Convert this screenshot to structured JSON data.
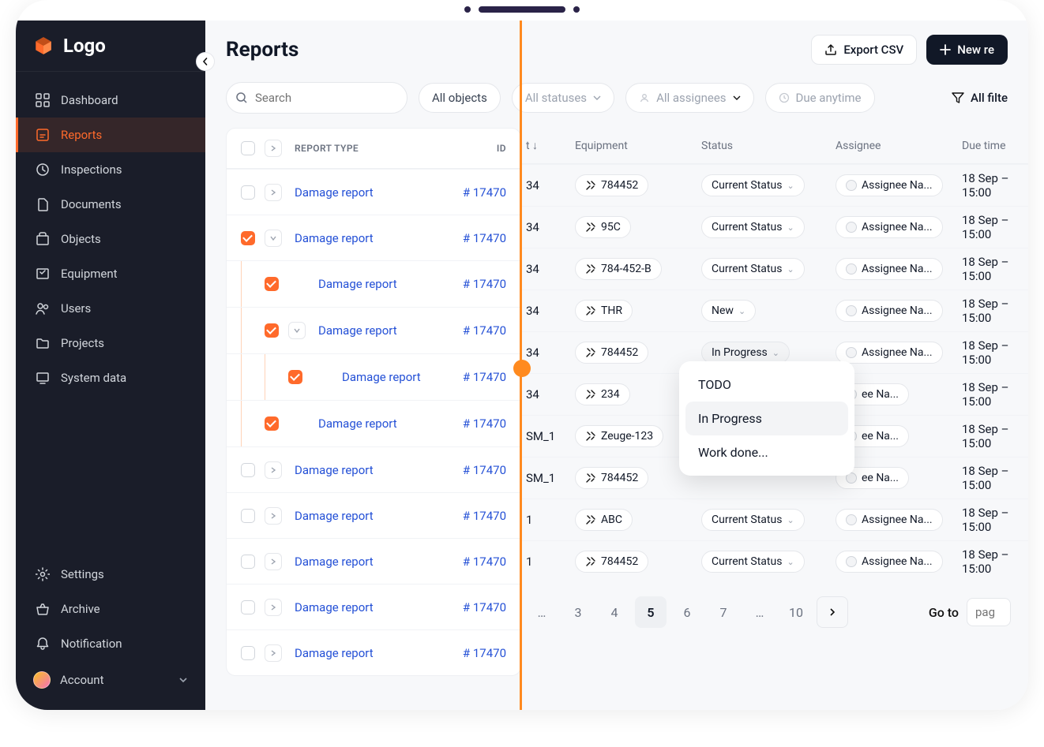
{
  "brand": {
    "name": "Logo"
  },
  "sidebar": {
    "items": [
      {
        "label": "Dashboard",
        "icon": "grid-icon"
      },
      {
        "label": "Reports",
        "icon": "report-icon",
        "active": true
      },
      {
        "label": "Inspections",
        "icon": "clock-icon"
      },
      {
        "label": "Documents",
        "icon": "file-icon"
      },
      {
        "label": "Objects",
        "icon": "building-icon"
      },
      {
        "label": "Equipment",
        "icon": "equipment-icon"
      },
      {
        "label": "Users",
        "icon": "users-icon"
      },
      {
        "label": "Projects",
        "icon": "folder-icon"
      },
      {
        "label": "System data",
        "icon": "monitor-icon"
      }
    ],
    "bottom": [
      {
        "label": "Settings",
        "icon": "gear-icon"
      },
      {
        "label": "Archive",
        "icon": "basket-icon"
      },
      {
        "label": "Notification",
        "icon": "bell-icon"
      }
    ],
    "account_label": "Account"
  },
  "header": {
    "title": "Reports",
    "export_label": "Export CSV",
    "new_label": "New re"
  },
  "filters": {
    "search_placeholder": "Search",
    "objects_label": "All objects",
    "statuses_label": "All statuses",
    "assignees_label": "All assignees",
    "due_label": "Due anytime",
    "allfilters_label": "All filte"
  },
  "left_table": {
    "col_type": "REPORT TYPE",
    "col_id": "ID",
    "rows": [
      {
        "checked": false,
        "expand": "right",
        "indent": 0,
        "type": "Damage report",
        "id": "# 17470"
      },
      {
        "checked": true,
        "expand": "down",
        "indent": 0,
        "type": "Damage report",
        "id": "# 17470"
      },
      {
        "checked": true,
        "expand": "none",
        "indent": 1,
        "type": "Damage report",
        "id": "# 17470"
      },
      {
        "checked": true,
        "expand": "down",
        "indent": 1,
        "type": "Damage report",
        "id": "# 17470"
      },
      {
        "checked": true,
        "expand": "none",
        "indent": 2,
        "type": "Damage report",
        "id": "# 17470"
      },
      {
        "checked": true,
        "expand": "none",
        "indent": 1,
        "type": "Damage report",
        "id": "# 17470"
      },
      {
        "checked": false,
        "expand": "right",
        "indent": 0,
        "type": "Damage report",
        "id": "# 17470"
      },
      {
        "checked": false,
        "expand": "right",
        "indent": 0,
        "type": "Damage report",
        "id": "# 17470"
      },
      {
        "checked": false,
        "expand": "right",
        "indent": 0,
        "type": "Damage report",
        "id": "# 17470"
      },
      {
        "checked": false,
        "expand": "right",
        "indent": 0,
        "type": "Damage report",
        "id": "# 17470"
      },
      {
        "checked": false,
        "expand": "right",
        "indent": 0,
        "type": "Damage report",
        "id": "# 17470"
      }
    ]
  },
  "right_table": {
    "col_t": "t ↓",
    "col_eq": "Equipment",
    "col_st": "Status",
    "col_as": "Assignee",
    "col_dt": "Due time",
    "rows": [
      {
        "t": "34",
        "eq": "784452",
        "status": "Current Status",
        "assignee": "Assignee Na...",
        "due": "18 Sep – 15:00"
      },
      {
        "t": "34",
        "eq": "95C",
        "status": "Current Status",
        "assignee": "Assignee Na...",
        "due": "18 Sep – 15:00"
      },
      {
        "t": "34",
        "eq": "784-452-B",
        "status": "Current Status",
        "assignee": "Assignee Na...",
        "due": "18 Sep – 15:00"
      },
      {
        "t": "34",
        "eq": "THR",
        "status": "New",
        "assignee": "Assignee Na...",
        "due": "18 Sep – 15:00"
      },
      {
        "t": "34",
        "eq": "784452",
        "status": "In Progress",
        "status_open": true,
        "assignee": "Assignee Na...",
        "due": "18 Sep – 15:00"
      },
      {
        "t": "34",
        "eq": "234",
        "status": "",
        "assignee": "ee Na...",
        "due": "18 Sep – 15:00"
      },
      {
        "t": "SM_1",
        "eq": "Zeuge-123",
        "status": "",
        "assignee": "ee Na...",
        "due": "18 Sep – 15:00"
      },
      {
        "t": "SM_1",
        "eq": "784452",
        "status": "",
        "assignee": "ee Na...",
        "due": "18 Sep – 15:00"
      },
      {
        "t": "1",
        "eq": "ABC",
        "status": "Current Status",
        "assignee": "Assignee Na...",
        "due": "18 Sep – 15:00"
      },
      {
        "t": "1",
        "eq": "784452",
        "status": "Current Status",
        "assignee": "Assignee Na...",
        "due": "18 Sep – 15:00"
      }
    ]
  },
  "status_dropdown": {
    "options": [
      "TODO",
      "In Progress",
      "Work done..."
    ],
    "active": "In Progress"
  },
  "pagination": {
    "ellipsis": "…",
    "pages": [
      "3",
      "4",
      "5",
      "6",
      "7"
    ],
    "active": "5",
    "more": "…",
    "last": "10",
    "goto_label": "Go to",
    "goto_placeholder": "pag"
  }
}
